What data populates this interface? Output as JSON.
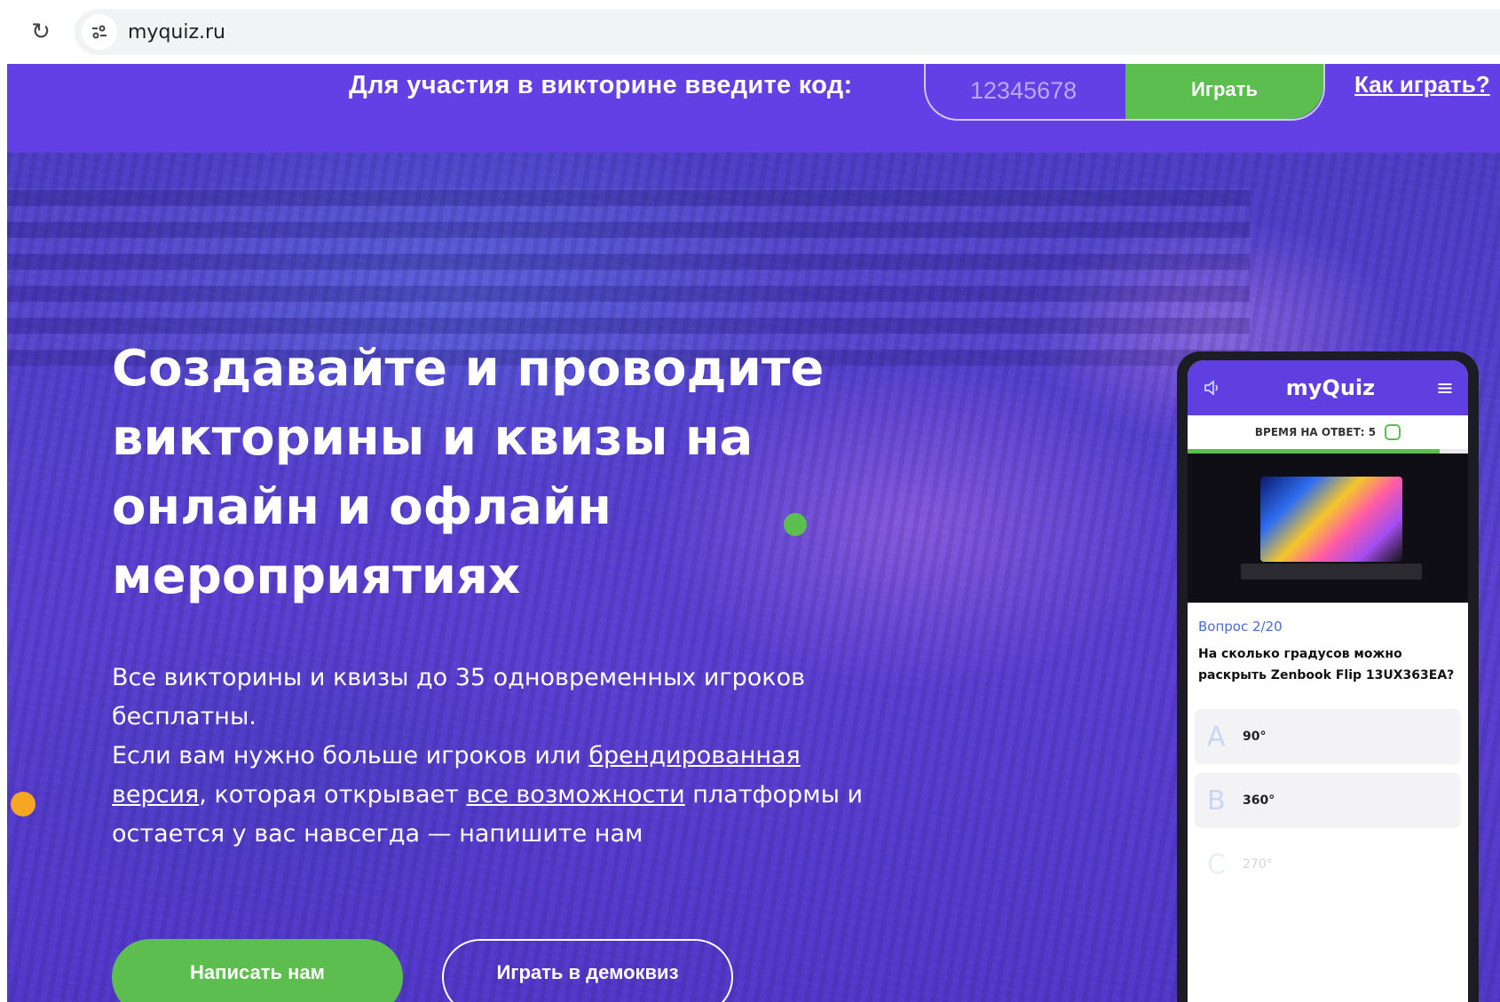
{
  "browser": {
    "url": "myquiz.ru"
  },
  "codebar": {
    "label": "Для участия в викторине введите код:",
    "code_placeholder": "12345678",
    "play_label": "Играть",
    "howto_label": "Как играть?"
  },
  "hero": {
    "headline": "Создавайте и проводите викторины и квизы на онлайн и офлайн мероприятиях",
    "body": {
      "line1": "Все викторины и квизы до 35 одновременных игроков бесплатны.",
      "line2_before": "Если вам нужно больше игроков или ",
      "link_branded": "брендированная версия",
      "line2_middle": ", которая открывает ",
      "link_features": "все возможности",
      "line2_after": " платформы и остается у вас навсегда — напишите нам"
    },
    "write_button": "Написать нам",
    "demo_button": "Играть в демоквиз"
  },
  "phone": {
    "logo": "myQuiz",
    "timer_label": "ВРЕМЯ НА ОТВЕТ: 5",
    "progress": 0.9,
    "question_number": "Вопрос 2/20",
    "question_text": "На сколько градусов можно раскрыть Zenbook Flip 13UX363EA?",
    "answers": [
      {
        "letter": "A",
        "text": "90°"
      },
      {
        "letter": "B",
        "text": "360°"
      },
      {
        "letter": "C",
        "text": "270°"
      }
    ]
  },
  "colors": {
    "purple": "#6240e6",
    "green": "#5cbe4e",
    "orange": "#f6a623"
  }
}
